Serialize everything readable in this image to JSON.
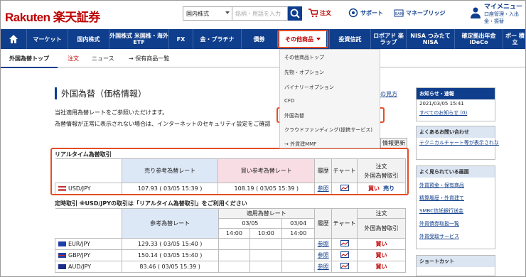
{
  "header": {
    "logo": "Rakuten 楽天証券",
    "select": "国内株式",
    "search_placeholder": "銘柄・用語を入力",
    "cart": "注文",
    "support": "サポート",
    "bridge": "マネーブリッジ",
    "mymenu_title": "マイメニュー",
    "mymenu_sub": "口座管理・入出金・振替"
  },
  "nav": [
    "マーケット",
    "国内株式",
    "外国株式 米国株・海外ETF",
    "FX",
    "金・プラチナ",
    "債券",
    "その他商品",
    "投資信託",
    "ロボアド 楽ラップ",
    "NISA つみたてNISA",
    "確定拠出年金 iDeCo",
    "ポー 積立"
  ],
  "tabs": [
    "外国為替トップ",
    "注文",
    "ニュース",
    "→ 保有商品一覧"
  ],
  "dropdown": [
    "その他商品トップ",
    "先物・オプション",
    "バイナリーオプション",
    "CFD",
    "外国為替",
    "クラウドファンディング(提携サービス)",
    "→ 外貨建MMF"
  ],
  "page": {
    "title": "外国為替（価格情報）",
    "desc1": "当社適用為替レートをご参照いただけます。",
    "desc2": "為替情報が正常に表示されない場合は、インターネットのセキュリティ設定をご確認",
    "mikata": "の見方",
    "update": "情報更新",
    "realtime": "リアルタイム為替取引",
    "sell_h": "売り参考為替レート",
    "buy_h": "買い参考為替レート",
    "hist_h": "履歴",
    "chart_h": "チャート",
    "order_h": "注文",
    "order_sub": "外国為替取引",
    "usd": "USD/JPY",
    "sell": "107.93 ( 03/05 15:39 )",
    "buy": "108.19 ( 03/05 15:39 )",
    "ref": "参照",
    "buy_b": "買い",
    "sell_b": "売り",
    "fixed": "定時取引 ※USD/JPYの取引は「リアルタイム為替取引」をご利用ください",
    "ref_h": "参考為替レート",
    "applied": "適用為替レート",
    "d1": "03/05",
    "d2": "03/04",
    "t1": "14:00",
    "t2": "10:00",
    "t3": "14:00"
  },
  "fixed_rows": [
    {
      "pair": "EUR/JPY",
      "rate": "129.33 ( 03/05 15:40 )"
    },
    {
      "pair": "GBP/JPY",
      "rate": "150.14 ( 03/05 15:40 )"
    },
    {
      "pair": "AUD/JPY",
      "rate": "83.46 ( 03/05 15:39 )"
    }
  ],
  "side": {
    "notice_h": "お知らせ・速報",
    "date": "2021/03/05 15:41",
    "all": "すべてのお知らせ (0)",
    "faq_h": "よくあるお問い合わせ",
    "faq1": "テクニカルチャート等が表示されな",
    "pop_h": "よく見られている画面",
    "pop": [
      "外貨預金・保有商品",
      "精算履歴・外貨建て",
      "SMBC信託銀行送金",
      "外貨債券取扱一覧",
      "外貨受取サービス"
    ],
    "short_h": "ショートカット"
  }
}
